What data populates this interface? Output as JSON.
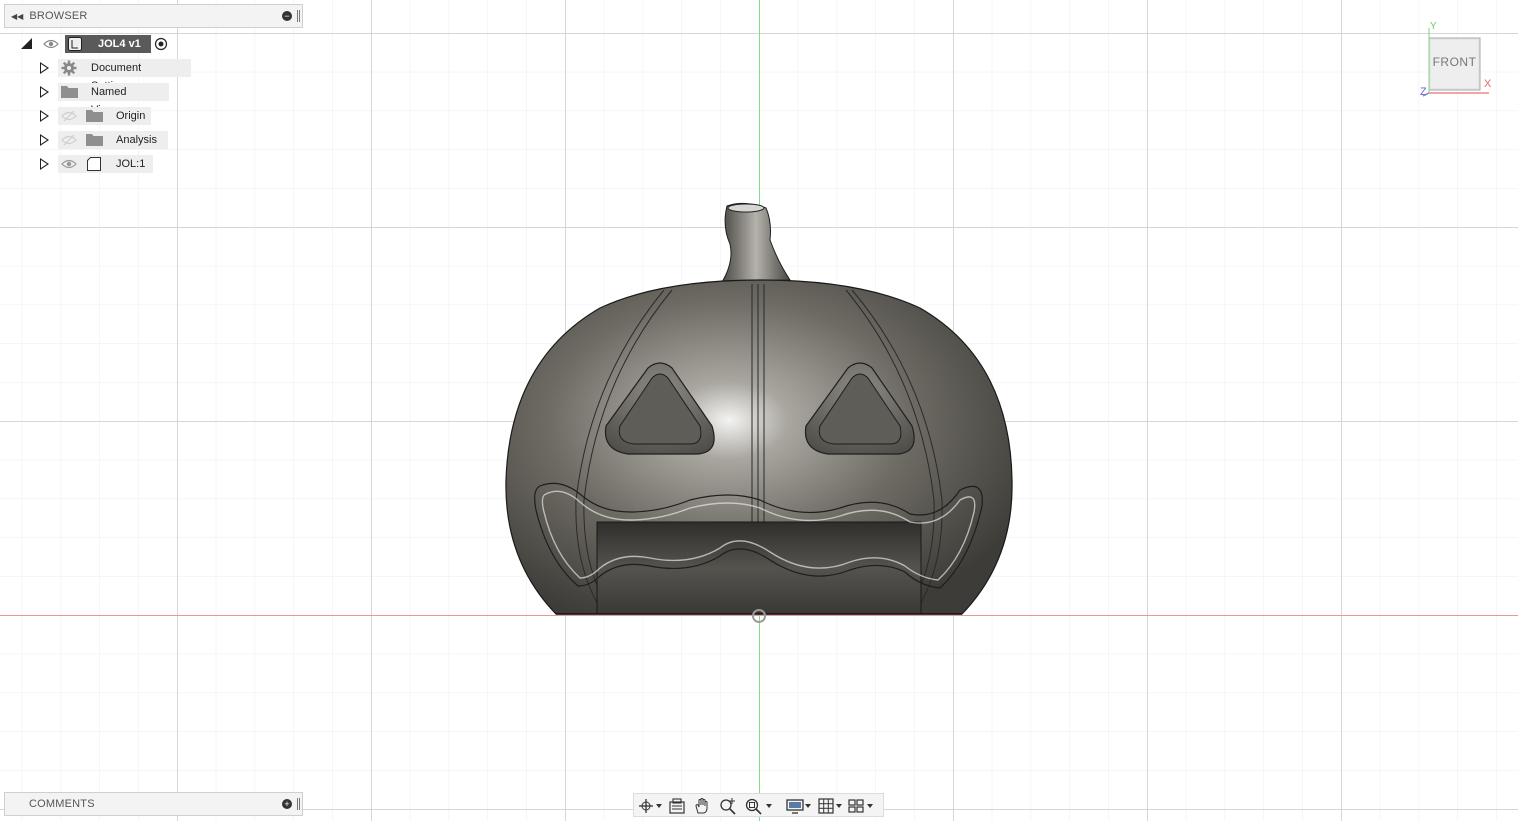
{
  "browser": {
    "header_label": "BROWSER",
    "root": {
      "label": "JOL4 v1"
    },
    "items": [
      {
        "label": "Document Settings",
        "icon": "gear-icon"
      },
      {
        "label": "Named Views",
        "icon": "folder-icon"
      },
      {
        "label": "Origin",
        "icon": "folder-icon"
      },
      {
        "label": "Analysis",
        "icon": "folder-icon"
      },
      {
        "label": "JOL:1",
        "icon": "component-icon"
      }
    ]
  },
  "comments": {
    "header_label": "COMMENTS"
  },
  "viewcube": {
    "face_label": "FRONT",
    "axis_x": "X",
    "axis_y": "Y",
    "axis_z": "Z"
  },
  "toolbar": {
    "items": [
      "orbit-icon",
      "look-at-icon",
      "pan-icon",
      "zoom-icon",
      "fit-icon",
      "display-settings-icon",
      "grid-settings-icon",
      "viewports-icon"
    ]
  },
  "colors": {
    "grid_minor": "#eaeaea",
    "grid_major": "#d4d4d4",
    "y_axis": "#7fd87f",
    "x_axis": "#e08a8a",
    "model": "#6b6862"
  }
}
